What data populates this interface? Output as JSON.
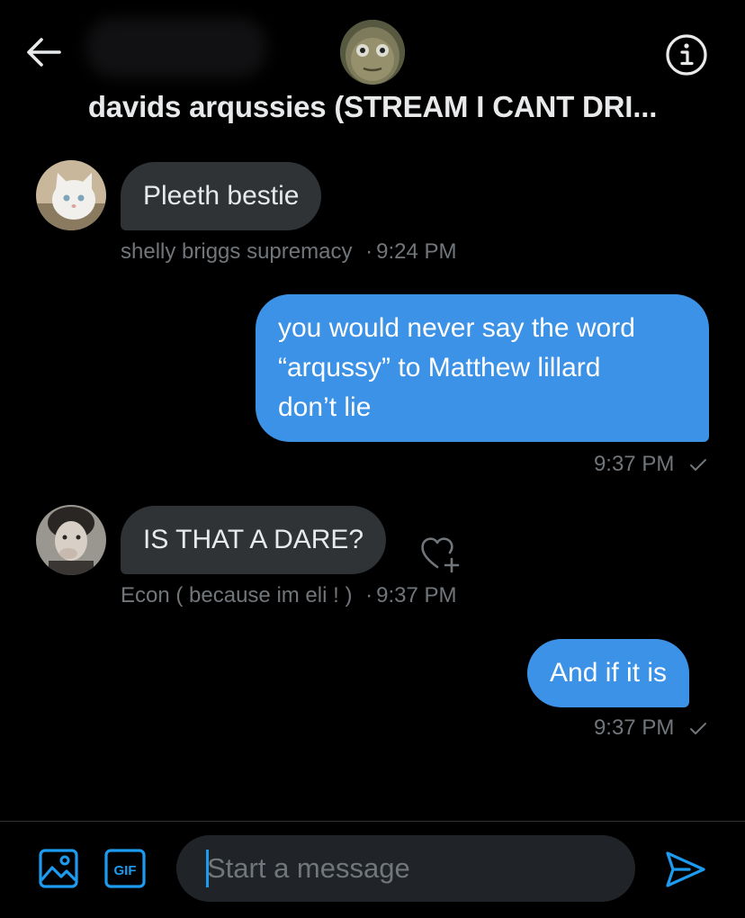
{
  "header": {
    "title": "davids arqussies (STREAM I CANT DRI..."
  },
  "messages": [
    {
      "direction": "incoming",
      "text": "Pleeth bestie",
      "sender": "shelly briggs supremacy",
      "time": "9:24 PM"
    },
    {
      "direction": "outgoing",
      "lines": [
        "you would never say the word",
        "“arqussy” to Matthew lillard",
        "don’t lie"
      ],
      "time": "9:37 PM"
    },
    {
      "direction": "incoming",
      "text": "IS THAT A DARE?",
      "sender": "Econ ( because im eli ! )",
      "time": "9:37 PM"
    },
    {
      "direction": "outgoing",
      "text": "And if it is",
      "time": "9:37 PM"
    }
  ],
  "composer": {
    "placeholder": "Start a message",
    "gif_label": "GIF"
  },
  "meta_separator": "·",
  "colors": {
    "accent": "#1d9bf0",
    "outgoing_bubble": "#3b92e6",
    "incoming_bubble": "#2f3336",
    "background": "#000000",
    "muted_text": "#71767b"
  },
  "icons": [
    "back-arrow-icon",
    "info-icon",
    "heart-plus-icon",
    "image-icon",
    "gif-icon",
    "send-icon",
    "checkmark-icon"
  ]
}
